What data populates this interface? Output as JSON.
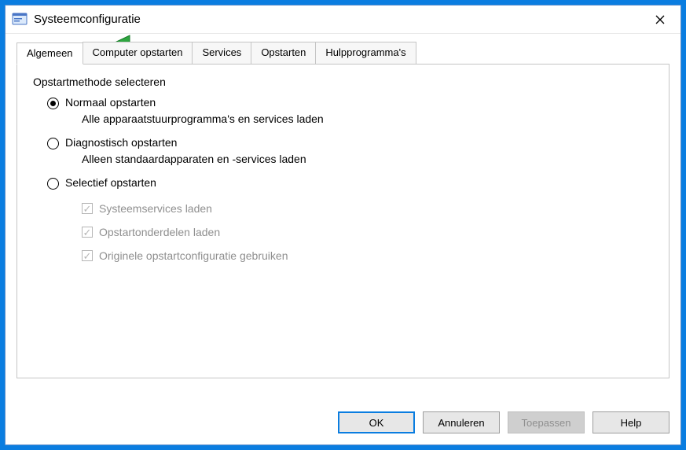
{
  "window": {
    "title": "Systeemconfiguratie"
  },
  "tabs": [
    {
      "label": "Algemeen",
      "active": true
    },
    {
      "label": "Computer opstarten",
      "active": false
    },
    {
      "label": "Services",
      "active": false
    },
    {
      "label": "Opstarten",
      "active": false
    },
    {
      "label": "Hulpprogramma's",
      "active": false
    }
  ],
  "group": {
    "legend": "Opstartmethode selecteren",
    "options": [
      {
        "label": "Normaal opstarten",
        "desc": "Alle apparaatstuurprogramma's en services laden",
        "checked": true
      },
      {
        "label": "Diagnostisch opstarten",
        "desc": "Alleen standaardapparaten en -services laden",
        "checked": false
      },
      {
        "label": "Selectief opstarten",
        "desc": "",
        "checked": false
      }
    ],
    "sub_checks": [
      {
        "label": "Systeemservices laden",
        "checked": true,
        "enabled": false
      },
      {
        "label": "Opstartonderdelen laden",
        "checked": true,
        "enabled": false
      },
      {
        "label": "Originele opstartconfiguratie gebruiken",
        "checked": true,
        "enabled": false
      }
    ]
  },
  "buttons": {
    "ok": "OK",
    "cancel": "Annuleren",
    "apply": "Toepassen",
    "help": "Help"
  }
}
